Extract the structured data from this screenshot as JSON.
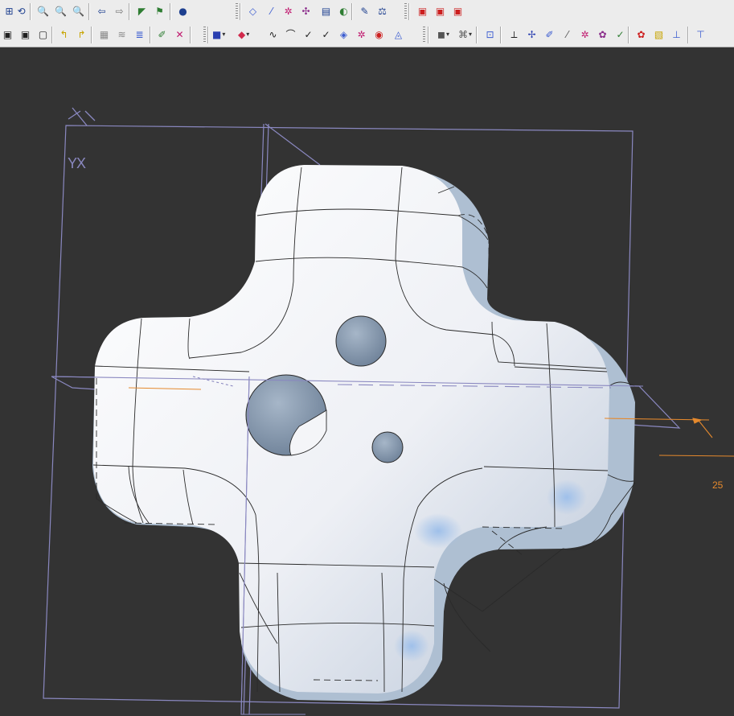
{
  "toolbar": {
    "row1": [
      {
        "name": "fit-all-icon",
        "glyph": "⊞",
        "color": "#1d3f8f"
      },
      {
        "name": "rotate-view-icon",
        "glyph": "⟲",
        "color": "#1d3f8f"
      },
      {
        "name": "zoom-in-icon",
        "glyph": "🔍",
        "color": "#1d3f8f"
      },
      {
        "name": "zoom-area-icon",
        "glyph": "🔍",
        "color": "#1d3f8f"
      },
      {
        "name": "zoom-out-icon",
        "glyph": "🔍",
        "color": "#1d3f8f"
      },
      {
        "name": "back-arrow-icon",
        "glyph": "⇦",
        "color": "#1d3f8f"
      },
      {
        "name": "forward-arrow-icon",
        "glyph": "⇨",
        "color": "#777777"
      },
      {
        "name": "sketch-icon",
        "glyph": "◤",
        "color": "#2e7d32"
      },
      {
        "name": "flag-icon",
        "glyph": "⚑",
        "color": "#2e7d32"
      },
      {
        "name": "sphere-icon",
        "glyph": "●",
        "color": "#1d3f8f"
      },
      {
        "name": "plane-icon",
        "glyph": "◇",
        "color": "#3a5bd0"
      },
      {
        "name": "line-icon",
        "glyph": "⁄",
        "color": "#3a5bd0"
      },
      {
        "name": "point-icon",
        "glyph": "✲",
        "color": "#c0186e"
      },
      {
        "name": "pin-icon",
        "glyph": "✣",
        "color": "#8a2b8a"
      },
      {
        "name": "table-icon",
        "glyph": "▤",
        "color": "#1d3f8f"
      },
      {
        "name": "shield-icon",
        "glyph": "◐",
        "color": "#2e7d32"
      },
      {
        "name": "measure-icon",
        "glyph": "✎",
        "color": "#1d3f8f"
      },
      {
        "name": "balance-icon",
        "glyph": "⚖",
        "color": "#1d3f8f"
      },
      {
        "name": "pdf-icon",
        "glyph": "▣",
        "color": "#cc1f1f"
      },
      {
        "name": "pdf-forward-icon",
        "glyph": "▣",
        "color": "#cc1f1f"
      },
      {
        "name": "pdf-export-icon",
        "glyph": "▣",
        "color": "#cc1f1f"
      }
    ],
    "row2": [
      {
        "name": "box-view-icon",
        "glyph": "▣",
        "color": "#1f1f1f"
      },
      {
        "name": "box-iso-icon",
        "glyph": "▣",
        "color": "#1f1f1f"
      },
      {
        "name": "box-front-icon",
        "glyph": "▢",
        "color": "#1f1f1f"
      },
      {
        "name": "corner-left-icon",
        "glyph": "↰",
        "color": "#c7a400"
      },
      {
        "name": "corner-right-icon",
        "glyph": "↱",
        "color": "#c7a400"
      },
      {
        "name": "grid-icon",
        "glyph": "▦",
        "color": "#8a8a8a"
      },
      {
        "name": "layers-icon",
        "glyph": "≋",
        "color": "#8a8a8a"
      },
      {
        "name": "stack-icon",
        "glyph": "≣",
        "color": "#3a5bd0"
      },
      {
        "name": "pen-icon",
        "glyph": "✐",
        "color": "#2e7d32"
      },
      {
        "name": "axis-icon",
        "glyph": "✕",
        "color": "#c0186e"
      },
      {
        "name": "cube-shaded-icon",
        "glyph": "■",
        "color": "#2a3fb0"
      },
      {
        "name": "cube-color-icon",
        "glyph": "◆",
        "color": "#d12a4c"
      },
      {
        "name": "spline-icon",
        "glyph": "∿",
        "color": "#1f1f1f"
      },
      {
        "name": "curve-icon",
        "glyph": "⌒",
        "color": "#1f1f1f"
      },
      {
        "name": "curve-x-icon",
        "glyph": "✓",
        "color": "#1f1f1f"
      },
      {
        "name": "curve-y-icon",
        "glyph": "✓",
        "color": "#1f1f1f"
      },
      {
        "name": "surface-icon",
        "glyph": "◈",
        "color": "#3a5bd0"
      },
      {
        "name": "surface-x-icon",
        "glyph": "✲",
        "color": "#c0186e"
      },
      {
        "name": "surface-edit-icon",
        "glyph": "◉",
        "color": "#cc1f1f"
      },
      {
        "name": "fillet-icon",
        "glyph": "◬",
        "color": "#3a5bd0"
      },
      {
        "name": "solid-icon",
        "glyph": "◼",
        "color": "#555555"
      },
      {
        "name": "boolean-icon",
        "glyph": "⌘",
        "color": "#555555"
      },
      {
        "name": "project-icon",
        "glyph": "⊡",
        "color": "#3a5bd0"
      },
      {
        "name": "split-icon",
        "glyph": "⟂",
        "color": "#1f1f1f"
      },
      {
        "name": "trim-icon",
        "glyph": "✢",
        "color": "#2a3fb0"
      },
      {
        "name": "extend-icon",
        "glyph": "✐",
        "color": "#3a5bd0"
      },
      {
        "name": "offset-icon",
        "glyph": "⁄",
        "color": "#555555"
      },
      {
        "name": "sweep-icon",
        "glyph": "✲",
        "color": "#c0186e"
      },
      {
        "name": "loft-icon",
        "glyph": "✿",
        "color": "#8a2b8a"
      },
      {
        "name": "analysis-icon",
        "glyph": "✓",
        "color": "#2e7d32"
      },
      {
        "name": "curvature-icon",
        "glyph": "✿",
        "color": "#cc1f1f"
      },
      {
        "name": "zebra-icon",
        "glyph": "▧",
        "color": "#c7a400"
      },
      {
        "name": "draft-icon",
        "glyph": "⊥",
        "color": "#3a5bd0"
      },
      {
        "name": "section-icon",
        "glyph": "⊤",
        "color": "#3a5bd0"
      }
    ]
  },
  "viewport": {
    "axis_label": "YX",
    "dimension_label": "25",
    "colors": {
      "background": "#333333",
      "part_body": "#f2f3f7",
      "part_shadow": "#9fb0c6",
      "edge_lines": "#2a2a2a",
      "datum_planes": "#8a88c0",
      "dimension": "#e5892d",
      "hole_fill": "#8fa2b6"
    }
  }
}
